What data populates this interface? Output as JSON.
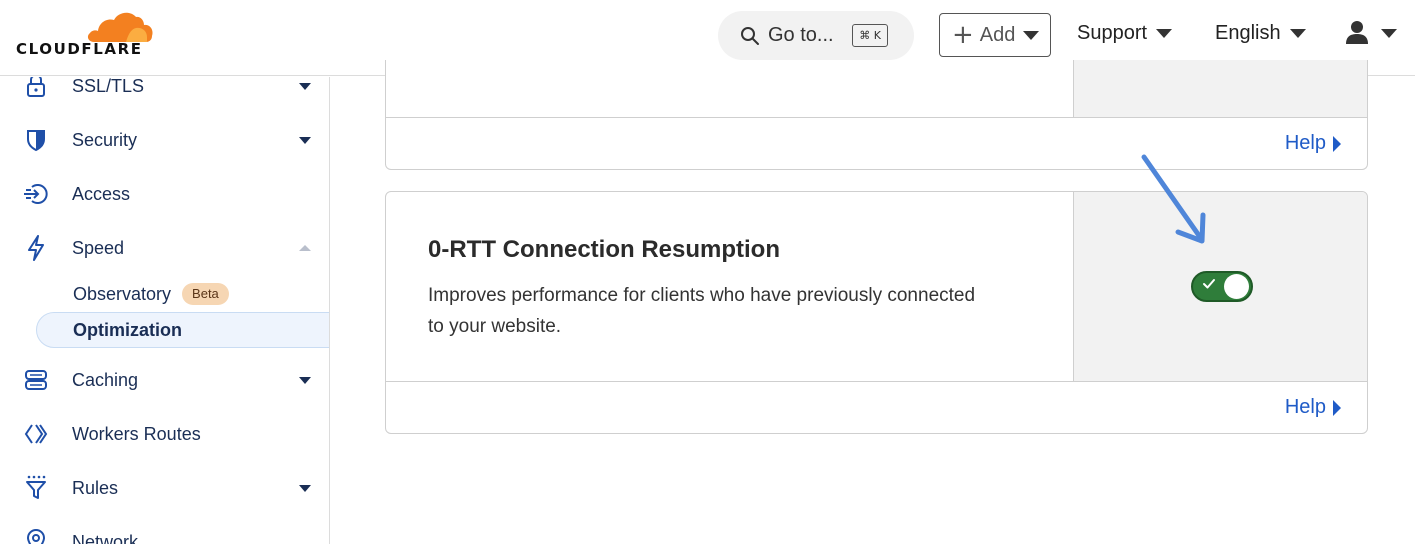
{
  "header": {
    "brand": "CLOUDFLARE",
    "search": {
      "label": "Go to...",
      "shortcut": "⌘ K"
    },
    "add_label": "Add",
    "support_label": "Support",
    "language_label": "English"
  },
  "sidebar": {
    "items": [
      {
        "label": "SSL/TLS",
        "icon": "lock-icon"
      },
      {
        "label": "Security",
        "icon": "shield-icon"
      },
      {
        "label": "Access",
        "icon": "access-icon"
      },
      {
        "label": "Speed",
        "icon": "lightning-icon"
      },
      {
        "label": "Caching",
        "icon": "server-icon"
      },
      {
        "label": "Workers Routes",
        "icon": "workers-icon"
      },
      {
        "label": "Rules",
        "icon": "funnel-icon"
      },
      {
        "label": "Network",
        "icon": "location-icon"
      }
    ],
    "speed_children": [
      {
        "label": "Observatory",
        "badge": "Beta"
      },
      {
        "label": "Optimization"
      }
    ]
  },
  "main": {
    "cards": [
      {
        "help_label": "Help"
      },
      {
        "title": "0-RTT Connection Resumption",
        "description": "Improves performance for clients who have previously connected to your website.",
        "toggle_on": true,
        "help_label": "Help"
      }
    ]
  },
  "colors": {
    "brand_orange": "#f38020",
    "link_blue": "#1f5bc7",
    "toggle_green": "#2f7d3a",
    "nav_text": "#1a2e55",
    "annotation_arrow": "#4f86d9"
  }
}
